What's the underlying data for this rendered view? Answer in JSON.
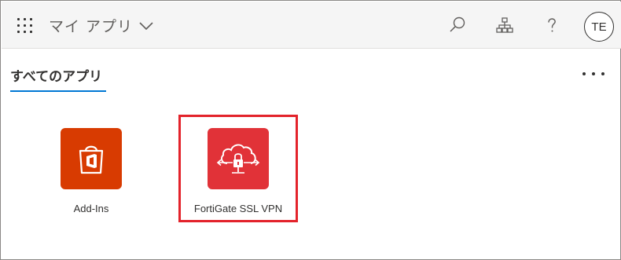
{
  "header": {
    "title": "マイ アプリ",
    "user_initials": "TE",
    "icons": [
      "waffle-icon",
      "chevron-down-icon",
      "search-icon",
      "org-chart-icon",
      "help-icon"
    ]
  },
  "tabs": [
    {
      "label": "すべてのアプリ",
      "active": true
    }
  ],
  "apps": [
    {
      "name": "Add-Ins",
      "icon": "office-bag-icon",
      "color": "#d83b01"
    },
    {
      "name": "FortiGate SSL VPN",
      "icon": "cloud-lock-icon",
      "color": "#e13238",
      "highlighted": true
    }
  ],
  "colors": {
    "accent": "#0078d4",
    "highlight_border": "#e3232b",
    "header_bg": "#f5f5f5"
  }
}
